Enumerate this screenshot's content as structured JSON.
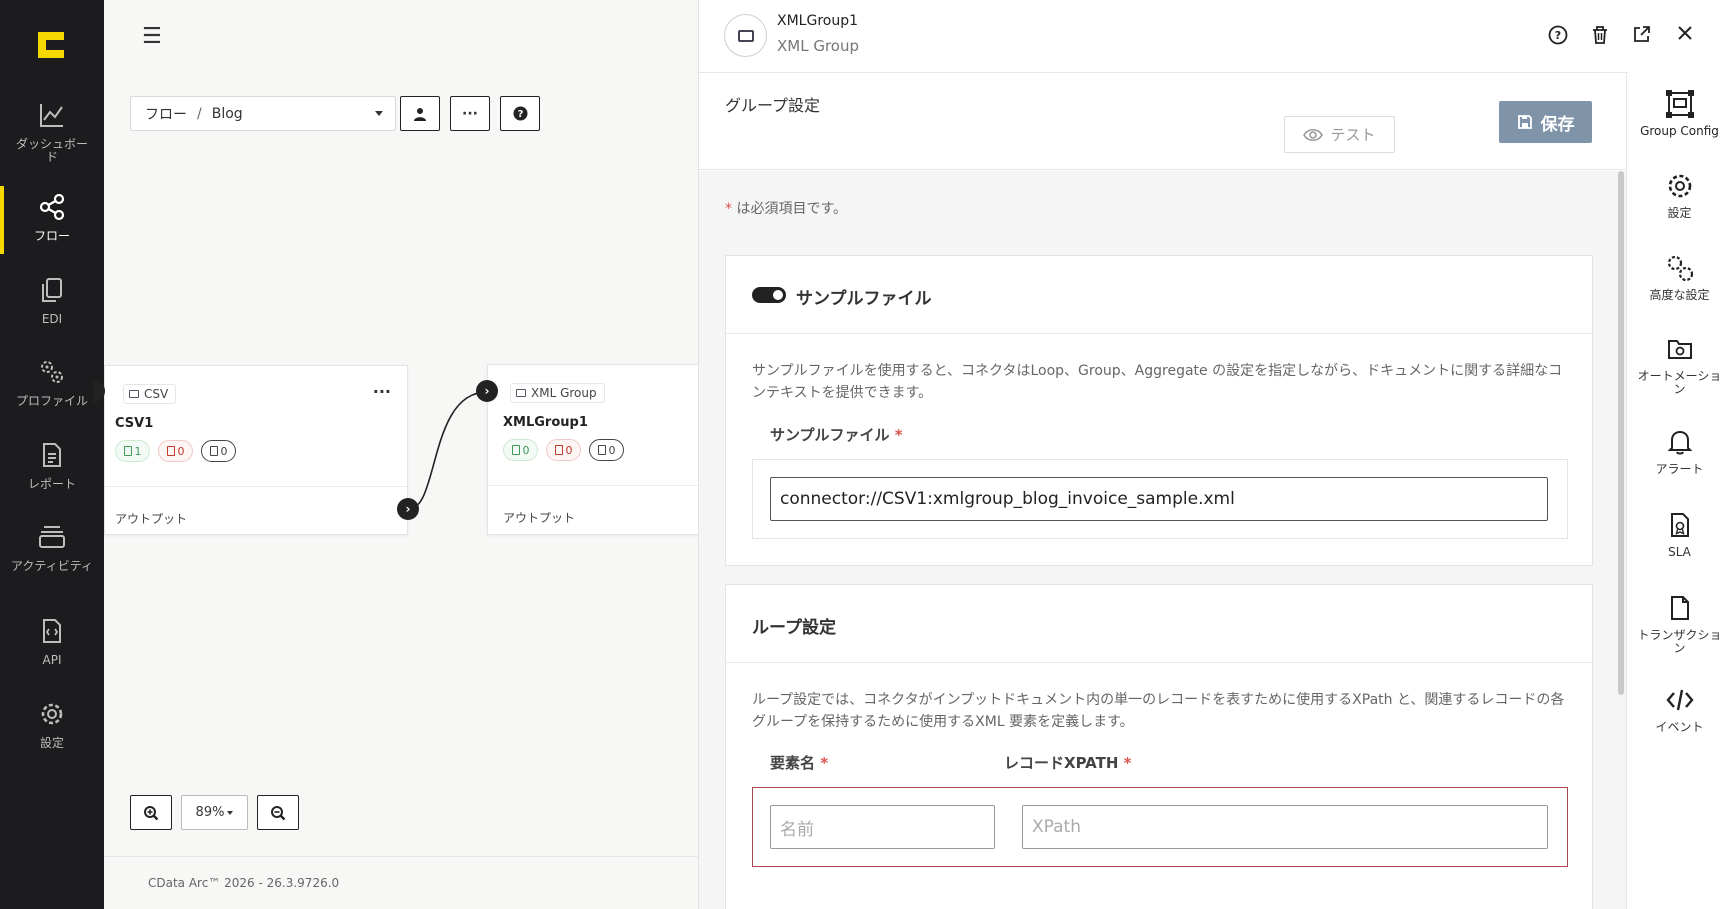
{
  "nav": {
    "items": [
      {
        "label": "ダッシュボード",
        "icon": "chart-line-icon"
      },
      {
        "label": "フロー",
        "icon": "share-icon"
      },
      {
        "label": "EDI",
        "icon": "files-icon"
      },
      {
        "label": "プロファイル",
        "icon": "gears-icon"
      },
      {
        "label": "レポート",
        "icon": "document-icon"
      },
      {
        "label": "アクティビティ",
        "icon": "layers-icon"
      },
      {
        "label": "API",
        "icon": "api-file-icon"
      },
      {
        "label": "設定",
        "icon": "gear-icon"
      }
    ],
    "accent": "#f5d800"
  },
  "breadcrumb": {
    "root": "フロー",
    "sep": "/",
    "current": "Blog"
  },
  "nodes": {
    "csv": {
      "tag": "CSV",
      "name": "CSV1",
      "counts": [
        "1",
        "0",
        "0"
      ],
      "output": "アウトプット"
    },
    "xml": {
      "tag": "XML Group",
      "name": "XMLGroup1",
      "counts": [
        "0",
        "0",
        "0"
      ],
      "output": "アウトプット"
    }
  },
  "zoom": {
    "level": "89%"
  },
  "footer": {
    "version": "CData Arc™ 2026 - 26.3.9726.0"
  },
  "panel": {
    "title": "XMLGroup1",
    "subtitle": "XML Group",
    "section_title": "グループ設定",
    "test_label": "テスト",
    "save_label": "保存",
    "required_ast": "*",
    "required_note": " は必須項目です。",
    "sample": {
      "title": "サンプルファイル",
      "desc": "サンプルファイルを使用すると、コネクタはLoop、Group、Aggregate の設定を指定しながら、ドキュメントに関する詳細なコンテキストを提供できます。",
      "field_label": "サンプルファイル",
      "value": "connector://CSV1:xmlgroup_blog_invoice_sample.xml"
    },
    "loop": {
      "title": "ループ設定",
      "desc": "ループ設定では、コネクタがインプットドキュメント内の単一のレコードを表すために使用するXPath と、関連するレコードの各グループを保持するために使用するXML 要素を定義します。",
      "element_label": "要素名",
      "xpath_label": "レコードXPATH",
      "element_placeholder": "名前",
      "xpath_placeholder": "XPath"
    },
    "save_color": "#7f93a9",
    "error_color": "#a9494f"
  },
  "rail": {
    "items": [
      {
        "label": "Group Config",
        "icon": "group-config-icon"
      },
      {
        "label": "設定",
        "icon": "gear-icon"
      },
      {
        "label": "高度な設定",
        "icon": "gears-icon"
      },
      {
        "label": "オートメーション",
        "icon": "folder-gear-icon"
      },
      {
        "label": "アラート",
        "icon": "bell-icon"
      },
      {
        "label": "SLA",
        "icon": "sla-file-icon"
      },
      {
        "label": "トランザクション",
        "icon": "file-icon"
      },
      {
        "label": "イベント",
        "icon": "code-icon"
      }
    ]
  }
}
